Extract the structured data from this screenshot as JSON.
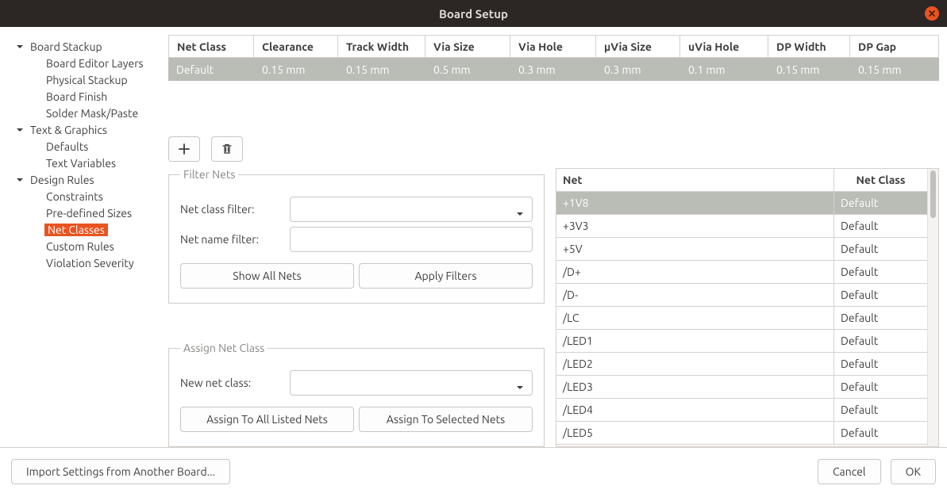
{
  "window": {
    "title": "Board Setup"
  },
  "sidebar": {
    "s1": {
      "label": "Board Stackup"
    },
    "s1c": [
      "Board Editor Layers",
      "Physical Stackup",
      "Board Finish",
      "Solder Mask/Paste"
    ],
    "s2": {
      "label": "Text & Graphics"
    },
    "s2c": [
      "Defaults",
      "Text Variables"
    ],
    "s3": {
      "label": "Design Rules"
    },
    "s3c": [
      "Constraints",
      "Pre-defined Sizes",
      "Net Classes",
      "Custom Rules",
      "Violation Severity"
    ],
    "selected": "Net Classes"
  },
  "net_class_table": {
    "headers": [
      "Net Class",
      "Clearance",
      "Track Width",
      "Via Size",
      "Via Hole",
      "µVia Size",
      "uVia Hole",
      "DP Width",
      "DP Gap"
    ],
    "rows": [
      [
        "Default",
        "0.15 mm",
        "0.15 mm",
        "0.5 mm",
        "0.3 mm",
        "0.3 mm",
        "0.1 mm",
        "0.15 mm",
        "0.15 mm"
      ]
    ]
  },
  "filter_panel": {
    "legend": "Filter Nets",
    "class_filter_label": "Net class filter:",
    "name_filter_label": "Net name filter:",
    "show_all": "Show All Nets",
    "apply": "Apply Filters"
  },
  "assign_panel": {
    "legend": "Assign Net Class",
    "new_label": "New net class:",
    "assign_all": "Assign To All Listed Nets",
    "assign_sel": "Assign To Selected Nets"
  },
  "nets": {
    "headers": [
      "Net",
      "Net Class"
    ],
    "rows": [
      [
        "+1V8",
        "Default"
      ],
      [
        "+3V3",
        "Default"
      ],
      [
        "+5V",
        "Default"
      ],
      [
        "/D+",
        "Default"
      ],
      [
        "/D-",
        "Default"
      ],
      [
        "/LC",
        "Default"
      ],
      [
        "/LED1",
        "Default"
      ],
      [
        "/LED2",
        "Default"
      ],
      [
        "/LED3",
        "Default"
      ],
      [
        "/LED4",
        "Default"
      ],
      [
        "/LED5",
        "Default"
      ]
    ]
  },
  "footer": {
    "import": "Import Settings from Another Board...",
    "cancel": "Cancel",
    "ok": "OK"
  }
}
